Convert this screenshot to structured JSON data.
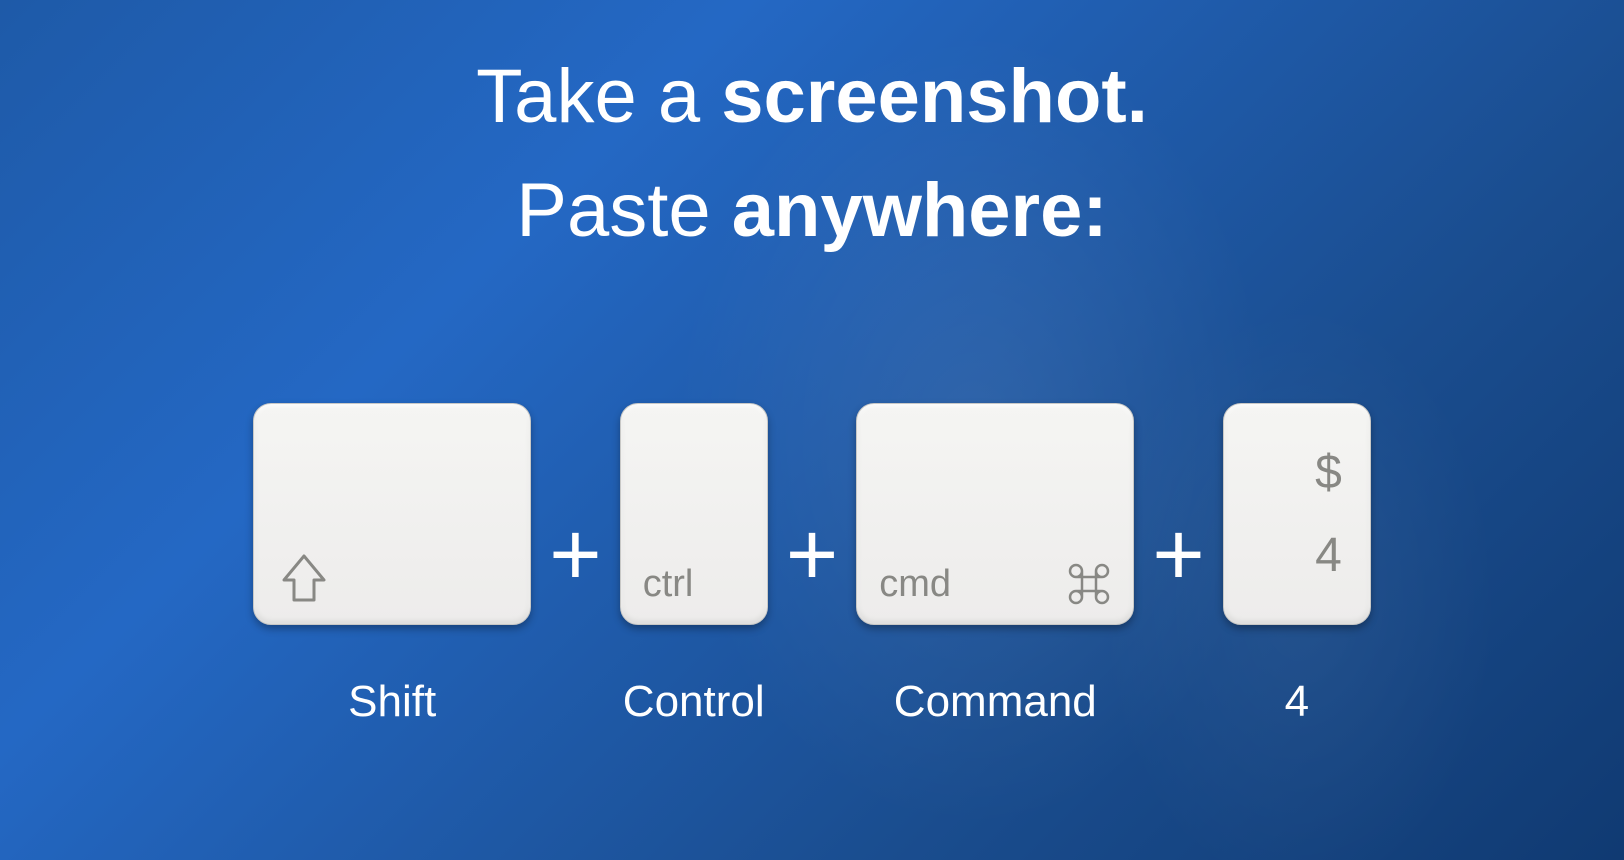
{
  "headline": {
    "line1_prefix": "Take a ",
    "line1_bold": "screenshot.",
    "line2_prefix": "Paste ",
    "line2_bold": "anywhere:"
  },
  "keys": {
    "shift": {
      "label": "Shift"
    },
    "ctrl": {
      "text": "ctrl",
      "label": "Control"
    },
    "cmd": {
      "text": "cmd",
      "label": "Command"
    },
    "four": {
      "symbol": "$",
      "number": "4",
      "label": "4"
    }
  },
  "separator": "+"
}
